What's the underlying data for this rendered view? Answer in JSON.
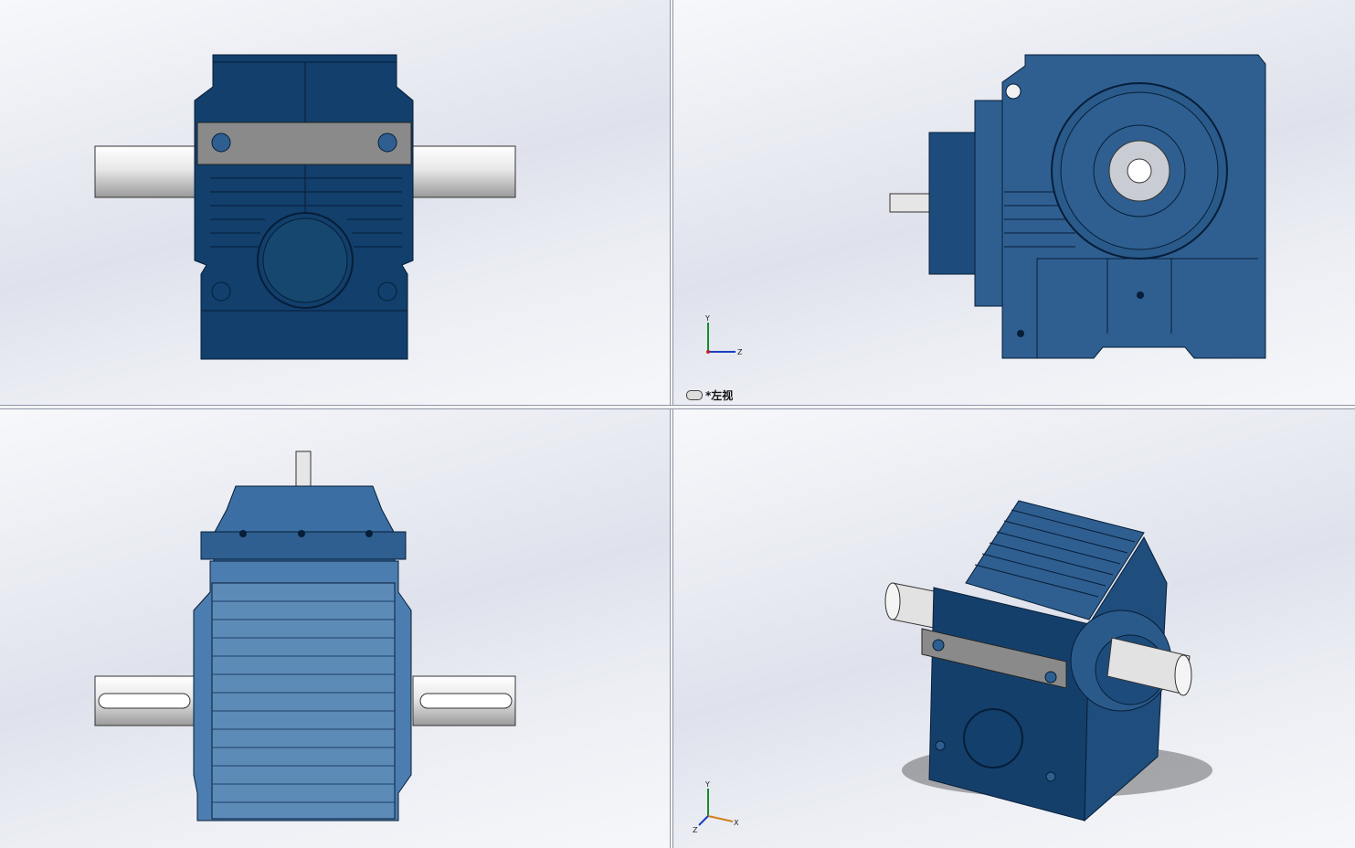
{
  "viewports": {
    "front": {
      "name": "front"
    },
    "left": {
      "label": "*左视",
      "triad": {
        "x": "",
        "y": "Y",
        "z": "Z"
      }
    },
    "top": {
      "name": "top"
    },
    "iso": {
      "triad": {
        "x": "X",
        "y": "Y",
        "z": "Z"
      }
    }
  },
  "colors": {
    "housing_dark": "#123f6b",
    "housing_mid": "#2f5f90",
    "housing_light": "#5d8bb8",
    "shaft": "#e6e6e6",
    "bracket": "#8a8a8a",
    "background": "#e4e7ee"
  }
}
